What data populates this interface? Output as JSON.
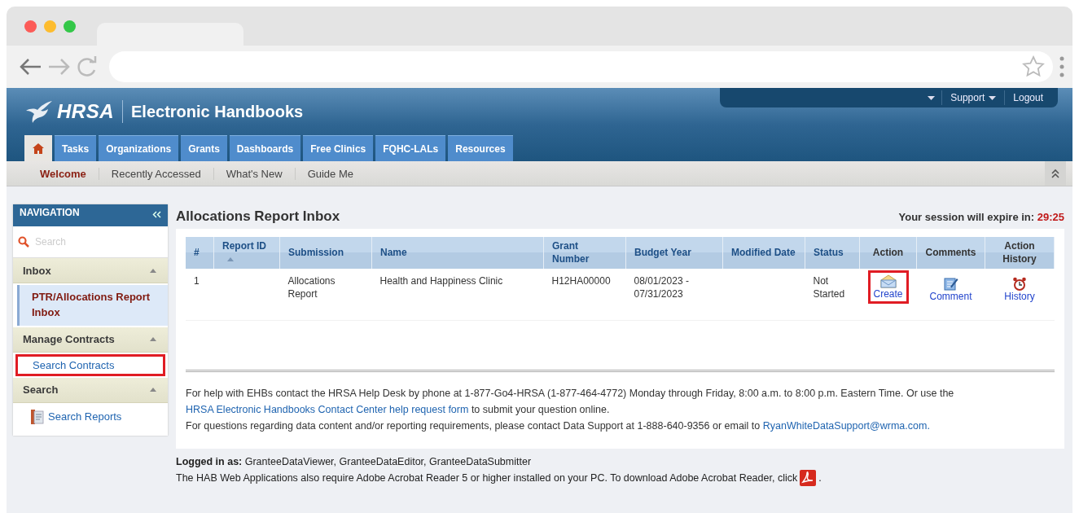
{
  "header": {
    "logo": "HRSA",
    "title": "Electronic Handbooks",
    "top_links": [
      {
        "label": "Support",
        "dropdown": true
      },
      {
        "label": "Logout",
        "dropdown": false
      }
    ]
  },
  "main_tabs": [
    {
      "kind": "home",
      "selected": true
    },
    {
      "kind": "tab",
      "label": "Tasks",
      "selected": false
    },
    {
      "kind": "tab",
      "label": "Organizations",
      "selected": false
    },
    {
      "kind": "tab",
      "label": "Grants",
      "selected": false
    },
    {
      "kind": "tab",
      "label": "Dashboards",
      "selected": false
    },
    {
      "kind": "tab",
      "label": "Free Clinics",
      "selected": false
    },
    {
      "kind": "tab",
      "label": "FQHC-LALs",
      "selected": false
    },
    {
      "kind": "tab",
      "label": "Resources",
      "selected": false
    }
  ],
  "sub_tabs": [
    {
      "label": "Welcome",
      "selected": true
    },
    {
      "label": "Recently Accessed",
      "selected": false
    },
    {
      "label": "What's New",
      "selected": false
    },
    {
      "label": "Guide Me",
      "selected": false
    }
  ],
  "sidebar": {
    "title": "NAVIGATION",
    "search": {
      "placeholder": "Search"
    },
    "sections": [
      {
        "title": "Inbox",
        "expanded": true,
        "items": [
          {
            "kind": "link",
            "label": "PTR/Allocations Report Inbox",
            "selected": true,
            "highlighted": false
          }
        ]
      },
      {
        "title": "Manage Contracts",
        "expanded": true,
        "items": [
          {
            "kind": "link",
            "label": "Search Contracts",
            "selected": false,
            "highlighted": true
          }
        ]
      },
      {
        "title": "Search",
        "expanded": true,
        "items": [
          {
            "kind": "report",
            "label": "Search Reports",
            "selected": false,
            "highlighted": false
          }
        ]
      }
    ]
  },
  "main": {
    "title": "Allocations Report Inbox",
    "session": {
      "label": "Your session will expire in:",
      "time": "29:25"
    },
    "table": {
      "columns": [
        {
          "label": "#",
          "link": true,
          "sorted": false
        },
        {
          "label": "Report ID",
          "link": true,
          "sorted": true
        },
        {
          "label": "Submission",
          "link": true,
          "sorted": false
        },
        {
          "label": "Name",
          "link": true,
          "sorted": false
        },
        {
          "label": "Grant Number",
          "link": true,
          "sorted": false
        },
        {
          "label": "Budget Year",
          "link": true,
          "sorted": false
        },
        {
          "label": "Modified Date",
          "link": true,
          "sorted": false
        },
        {
          "label": "Status",
          "link": true,
          "sorted": false
        },
        {
          "label": "Action",
          "link": false,
          "sorted": false
        },
        {
          "label": "Comments",
          "link": false,
          "sorted": false
        },
        {
          "label": "Action History",
          "link": false,
          "sorted": false
        }
      ],
      "rows": [
        {
          "cells": [
            "1",
            "",
            "Allocations Report",
            "Health and Happiness Clinic",
            "H12HA00000",
            "08/01/2023 - 07/31/2023",
            "",
            "Not Started"
          ],
          "actions": [
            {
              "kind": "create",
              "label": "Create",
              "highlighted": true
            },
            {
              "kind": "comment",
              "label": "Comment",
              "highlighted": false
            },
            {
              "kind": "history",
              "label": "History",
              "highlighted": false
            }
          ]
        }
      ]
    },
    "help": [
      [
        {
          "text": "For help with EHBs contact the HRSA Help Desk by phone at 1-877-Go4-HRSA (1-877-464-4772) Monday through Friday, 8:00 a.m. to 8:00 p.m. Eastern Time. Or use the ",
          "link": false
        },
        {
          "text": "HRSA Electronic Handbooks Contact Center help request form",
          "link": true
        },
        {
          "text": " to submit your question online.",
          "link": false
        }
      ],
      [
        {
          "text": "For questions regarding data content and/or reporting requirements, please contact Data Support at 1-888-640-9356 or email to ",
          "link": false
        },
        {
          "text": "RyanWhiteDataSupport@wrma.com.",
          "link": true
        }
      ]
    ]
  },
  "footer": {
    "logged_in_label": "Logged in as:",
    "logged_in_value": "GranteeDataViewer, GranteeDataEditor, GranteeDataSubmitter",
    "adobe_note": "The HAB Web Applications also require Adobe Acrobat Reader 5 or higher installed on your PC. To download Adobe Acrobat Reader, click",
    "adobe_suffix": "."
  }
}
